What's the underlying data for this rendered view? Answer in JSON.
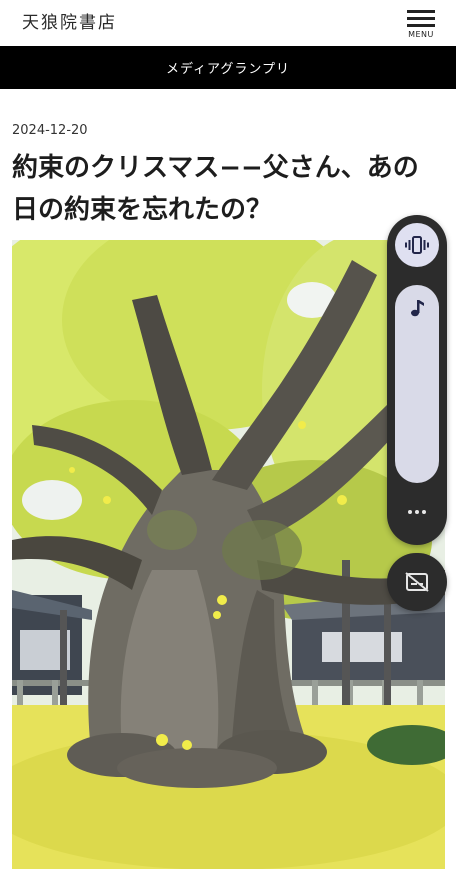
{
  "header": {
    "site_name": "天狼院書店",
    "menu_label": "MENU"
  },
  "category": {
    "label": "メディアグランプリ"
  },
  "article": {
    "date": "2024-12-20",
    "title": "約束のクリスマス−−父さん、あの日の約束を忘れたの？"
  },
  "photo": {
    "subject": "ginkgo-tree"
  },
  "volume_panel": {
    "level": 1.0,
    "icons": [
      "vibrate-icon",
      "music-note-icon",
      "more-dots-icon",
      "captions-off-icon"
    ]
  },
  "colors": {
    "category_bar": "#000000",
    "panel": "#2c2c2c",
    "panel_button": "#dfe0f1"
  }
}
